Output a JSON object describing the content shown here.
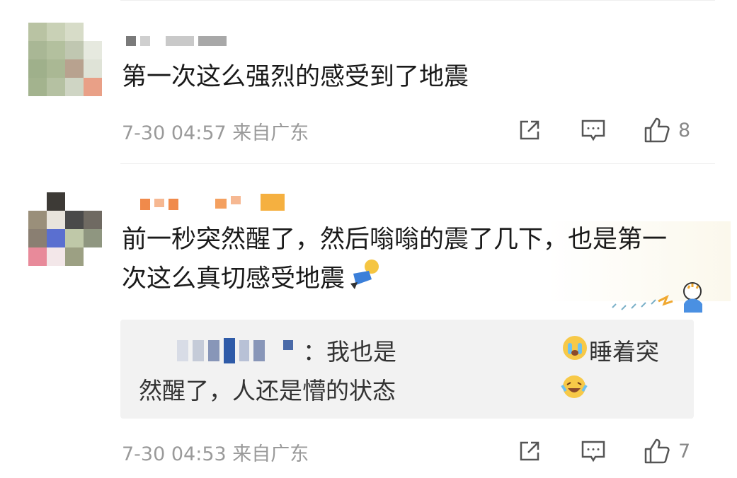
{
  "comments": [
    {
      "text": "第一次这么强烈的感受到了地震",
      "time": "7-30 04:57",
      "location": "来自广东",
      "likes": "8"
    },
    {
      "text": "前一秒突然醒了，然后嗡嗡的震了几下，也是第一次这么真切感受地震",
      "time": "7-30 04:53",
      "location": "来自广东",
      "likes": "7",
      "reply": {
        "text": "：我也是",
        "text2": "睡着突然醒了，人还是懵的状态"
      }
    }
  ],
  "icons": {
    "share": "share-icon",
    "comment": "comment-icon",
    "like": "thumbs-up-icon",
    "emoji_doll": "spinning-doll-emoji",
    "emoji_cry": "crying-face-emoji",
    "emoji_laugh": "laughing-tears-emoji"
  },
  "colors": {
    "text": "#1a1a1a",
    "meta": "#9a9a9a",
    "reply_bg": "#f2f2f2"
  }
}
